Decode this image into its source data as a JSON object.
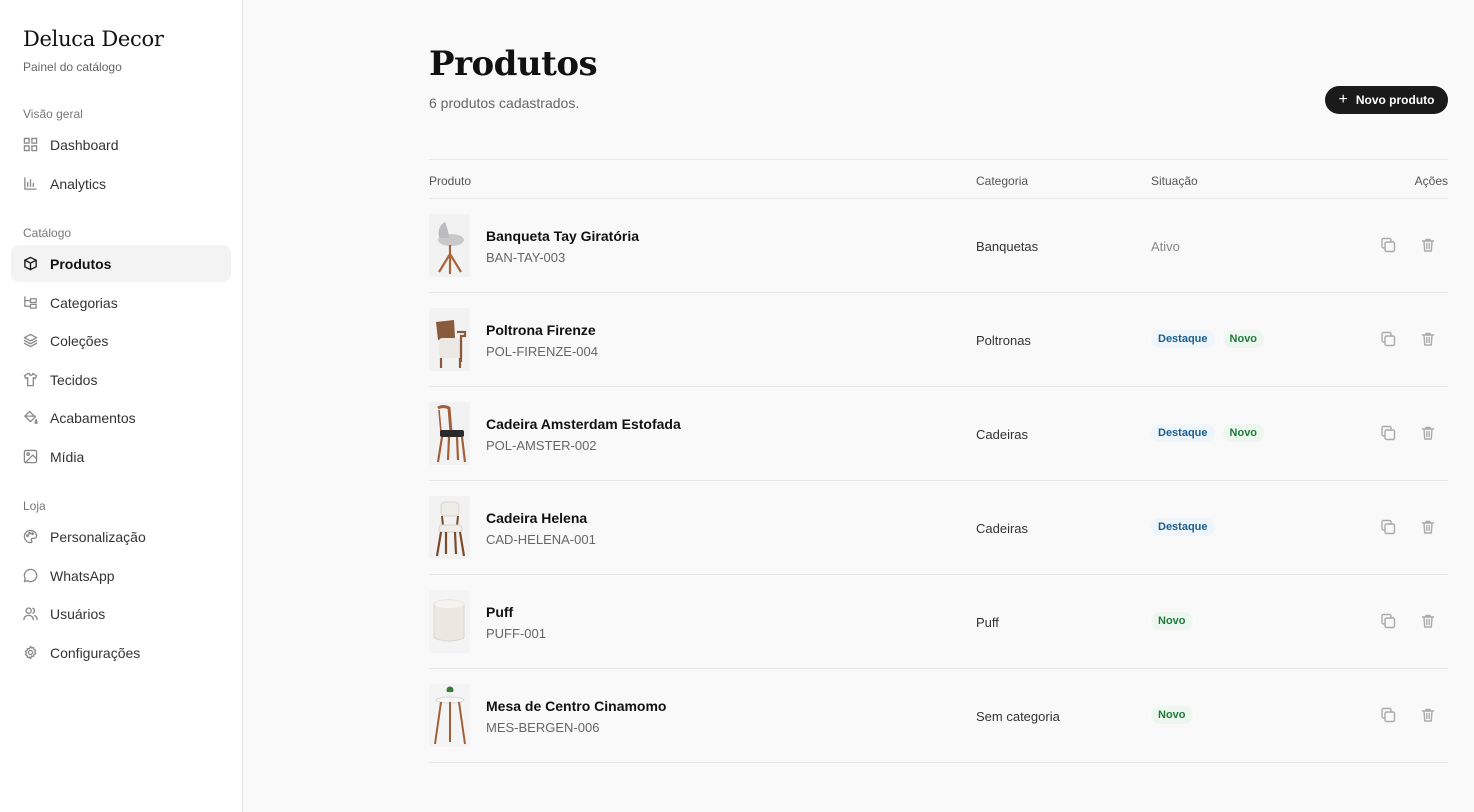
{
  "brand": {
    "name": "Deluca Decor",
    "subtitle": "Painel do catálogo"
  },
  "sidebar": {
    "sections": [
      {
        "label": "Visão geral"
      },
      {
        "label": "Catálogo"
      },
      {
        "label": "Loja"
      }
    ],
    "items": [
      {
        "label": "Dashboard",
        "icon": "dashboard-icon"
      },
      {
        "label": "Analytics",
        "icon": "bar-chart-icon"
      },
      {
        "label": "Produtos",
        "icon": "box-icon",
        "active": true
      },
      {
        "label": "Categorias",
        "icon": "tree-icon"
      },
      {
        "label": "Coleções",
        "icon": "layers-icon"
      },
      {
        "label": "Tecidos",
        "icon": "shirt-icon"
      },
      {
        "label": "Acabamentos",
        "icon": "paint-bucket-icon"
      },
      {
        "label": "Mídia",
        "icon": "image-icon"
      },
      {
        "label": "Personalização",
        "icon": "palette-icon"
      },
      {
        "label": "WhatsApp",
        "icon": "chat-bubble-icon"
      },
      {
        "label": "Usuários",
        "icon": "users-icon"
      },
      {
        "label": "Configurações",
        "icon": "gear-icon"
      }
    ]
  },
  "main": {
    "title": "Produtos",
    "subtitle": "6 produtos cadastrados.",
    "new_button": "Novo produto"
  },
  "table": {
    "headers": {
      "product": "Produto",
      "category": "Categoria",
      "status": "Situação",
      "actions": "Ações"
    },
    "rows": [
      {
        "name": "Banqueta Tay Giratória",
        "sku": "BAN-TAY-003",
        "category": "Banquetas",
        "status": "Ativo",
        "badges": []
      },
      {
        "name": "Poltrona Firenze",
        "sku": "POL-FIRENZE-004",
        "category": "Poltronas",
        "badges": [
          "Destaque",
          "Novo"
        ]
      },
      {
        "name": "Cadeira Amsterdam Estofada",
        "sku": "POL-AMSTER-002",
        "category": "Cadeiras",
        "badges": [
          "Destaque",
          "Novo"
        ]
      },
      {
        "name": "Cadeira Helena",
        "sku": "CAD-HELENA-001",
        "category": "Cadeiras",
        "badges": [
          "Destaque"
        ]
      },
      {
        "name": "Puff",
        "sku": "PUFF-001",
        "category": "Puff",
        "badges": [
          "Novo"
        ]
      },
      {
        "name": "Mesa de Centro Cinamomo",
        "sku": "MES-BERGEN-006",
        "category": "Sem categoria",
        "badges": [
          "Novo"
        ]
      }
    ]
  },
  "colors": {
    "button_bg": "#1a1a1a",
    "badge_destaque": "#1c5f8f",
    "badge_novo": "#1f7a3a"
  }
}
